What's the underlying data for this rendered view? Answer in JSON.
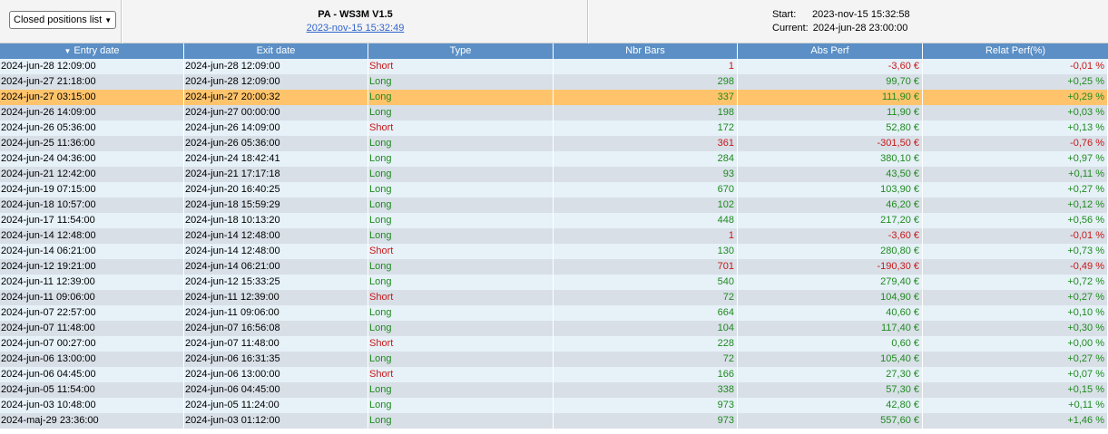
{
  "toolbar": {
    "list_select": "Closed positions list"
  },
  "strategy": {
    "title": "PA - WS3M V1.5",
    "date": "2023-nov-15 15:32:49"
  },
  "info": {
    "start_label": "Start:",
    "start_value": "2023-nov-15 15:32:58",
    "current_label": "Current:",
    "current_value": "2024-jun-28 23:00:00"
  },
  "colors": {
    "header_bg": "#5b8fc5",
    "row_odd": "#e6f1f8",
    "row_even": "#d8dfe7",
    "selected": "#ffc46b",
    "positive": "#1f8a1f",
    "negative": "#c81818"
  },
  "columns": [
    "Entry date",
    "Exit date",
    "Type",
    "Nbr Bars",
    "Abs Perf",
    "Relat Perf(%)"
  ],
  "rows": [
    {
      "entry": "2024-jun-28 12:09:00",
      "exit": "2024-jun-28 12:09:00",
      "type": "Short",
      "bars": "1",
      "abs": "-3,60 €",
      "rel": "-0,01 %",
      "win": false
    },
    {
      "entry": "2024-jun-27 21:18:00",
      "exit": "2024-jun-28 12:09:00",
      "type": "Long",
      "bars": "298",
      "abs": "99,70 €",
      "rel": "+0,25 %",
      "win": true
    },
    {
      "entry": "2024-jun-27 03:15:00",
      "exit": "2024-jun-27 20:00:32",
      "type": "Long",
      "bars": "337",
      "abs": "111,90 €",
      "rel": "+0,29 %",
      "win": true,
      "selected": true
    },
    {
      "entry": "2024-jun-26 14:09:00",
      "exit": "2024-jun-27 00:00:00",
      "type": "Long",
      "bars": "198",
      "abs": "11,90 €",
      "rel": "+0,03 %",
      "win": true
    },
    {
      "entry": "2024-jun-26 05:36:00",
      "exit": "2024-jun-26 14:09:00",
      "type": "Short",
      "bars": "172",
      "abs": "52,80 €",
      "rel": "+0,13 %",
      "win": true
    },
    {
      "entry": "2024-jun-25 11:36:00",
      "exit": "2024-jun-26 05:36:00",
      "type": "Long",
      "bars": "361",
      "abs": "-301,50 €",
      "rel": "-0,76 %",
      "win": false
    },
    {
      "entry": "2024-jun-24 04:36:00",
      "exit": "2024-jun-24 18:42:41",
      "type": "Long",
      "bars": "284",
      "abs": "380,10 €",
      "rel": "+0,97 %",
      "win": true
    },
    {
      "entry": "2024-jun-21 12:42:00",
      "exit": "2024-jun-21 17:17:18",
      "type": "Long",
      "bars": "93",
      "abs": "43,50 €",
      "rel": "+0,11 %",
      "win": true
    },
    {
      "entry": "2024-jun-19 07:15:00",
      "exit": "2024-jun-20 16:40:25",
      "type": "Long",
      "bars": "670",
      "abs": "103,90 €",
      "rel": "+0,27 %",
      "win": true
    },
    {
      "entry": "2024-jun-18 10:57:00",
      "exit": "2024-jun-18 15:59:29",
      "type": "Long",
      "bars": "102",
      "abs": "46,20 €",
      "rel": "+0,12 %",
      "win": true
    },
    {
      "entry": "2024-jun-17 11:54:00",
      "exit": "2024-jun-18 10:13:20",
      "type": "Long",
      "bars": "448",
      "abs": "217,20 €",
      "rel": "+0,56 %",
      "win": true
    },
    {
      "entry": "2024-jun-14 12:48:00",
      "exit": "2024-jun-14 12:48:00",
      "type": "Long",
      "bars": "1",
      "abs": "-3,60 €",
      "rel": "-0,01 %",
      "win": false
    },
    {
      "entry": "2024-jun-14 06:21:00",
      "exit": "2024-jun-14 12:48:00",
      "type": "Short",
      "bars": "130",
      "abs": "280,80 €",
      "rel": "+0,73 %",
      "win": true
    },
    {
      "entry": "2024-jun-12 19:21:00",
      "exit": "2024-jun-14 06:21:00",
      "type": "Long",
      "bars": "701",
      "abs": "-190,30 €",
      "rel": "-0,49 %",
      "win": false
    },
    {
      "entry": "2024-jun-11 12:39:00",
      "exit": "2024-jun-12 15:33:25",
      "type": "Long",
      "bars": "540",
      "abs": "279,40 €",
      "rel": "+0,72 %",
      "win": true
    },
    {
      "entry": "2024-jun-11 09:06:00",
      "exit": "2024-jun-11 12:39:00",
      "type": "Short",
      "bars": "72",
      "abs": "104,90 €",
      "rel": "+0,27 %",
      "win": true
    },
    {
      "entry": "2024-jun-07 22:57:00",
      "exit": "2024-jun-11 09:06:00",
      "type": "Long",
      "bars": "664",
      "abs": "40,60 €",
      "rel": "+0,10 %",
      "win": true
    },
    {
      "entry": "2024-jun-07 11:48:00",
      "exit": "2024-jun-07 16:56:08",
      "type": "Long",
      "bars": "104",
      "abs": "117,40 €",
      "rel": "+0,30 %",
      "win": true
    },
    {
      "entry": "2024-jun-07 00:27:00",
      "exit": "2024-jun-07 11:48:00",
      "type": "Short",
      "bars": "228",
      "abs": "0,60 €",
      "rel": "+0,00 %",
      "win": true
    },
    {
      "entry": "2024-jun-06 13:00:00",
      "exit": "2024-jun-06 16:31:35",
      "type": "Long",
      "bars": "72",
      "abs": "105,40 €",
      "rel": "+0,27 %",
      "win": true
    },
    {
      "entry": "2024-jun-06 04:45:00",
      "exit": "2024-jun-06 13:00:00",
      "type": "Short",
      "bars": "166",
      "abs": "27,30 €",
      "rel": "+0,07 %",
      "win": true
    },
    {
      "entry": "2024-jun-05 11:54:00",
      "exit": "2024-jun-06 04:45:00",
      "type": "Long",
      "bars": "338",
      "abs": "57,30 €",
      "rel": "+0,15 %",
      "win": true
    },
    {
      "entry": "2024-jun-03 10:48:00",
      "exit": "2024-jun-05 11:24:00",
      "type": "Long",
      "bars": "973",
      "abs": "42,80 €",
      "rel": "+0,11 %",
      "win": true
    },
    {
      "entry": "2024-maj-29 23:36:00",
      "exit": "2024-jun-03 01:12:00",
      "type": "Long",
      "bars": "973",
      "abs": "557,60 €",
      "rel": "+1,46 %",
      "win": true
    }
  ]
}
